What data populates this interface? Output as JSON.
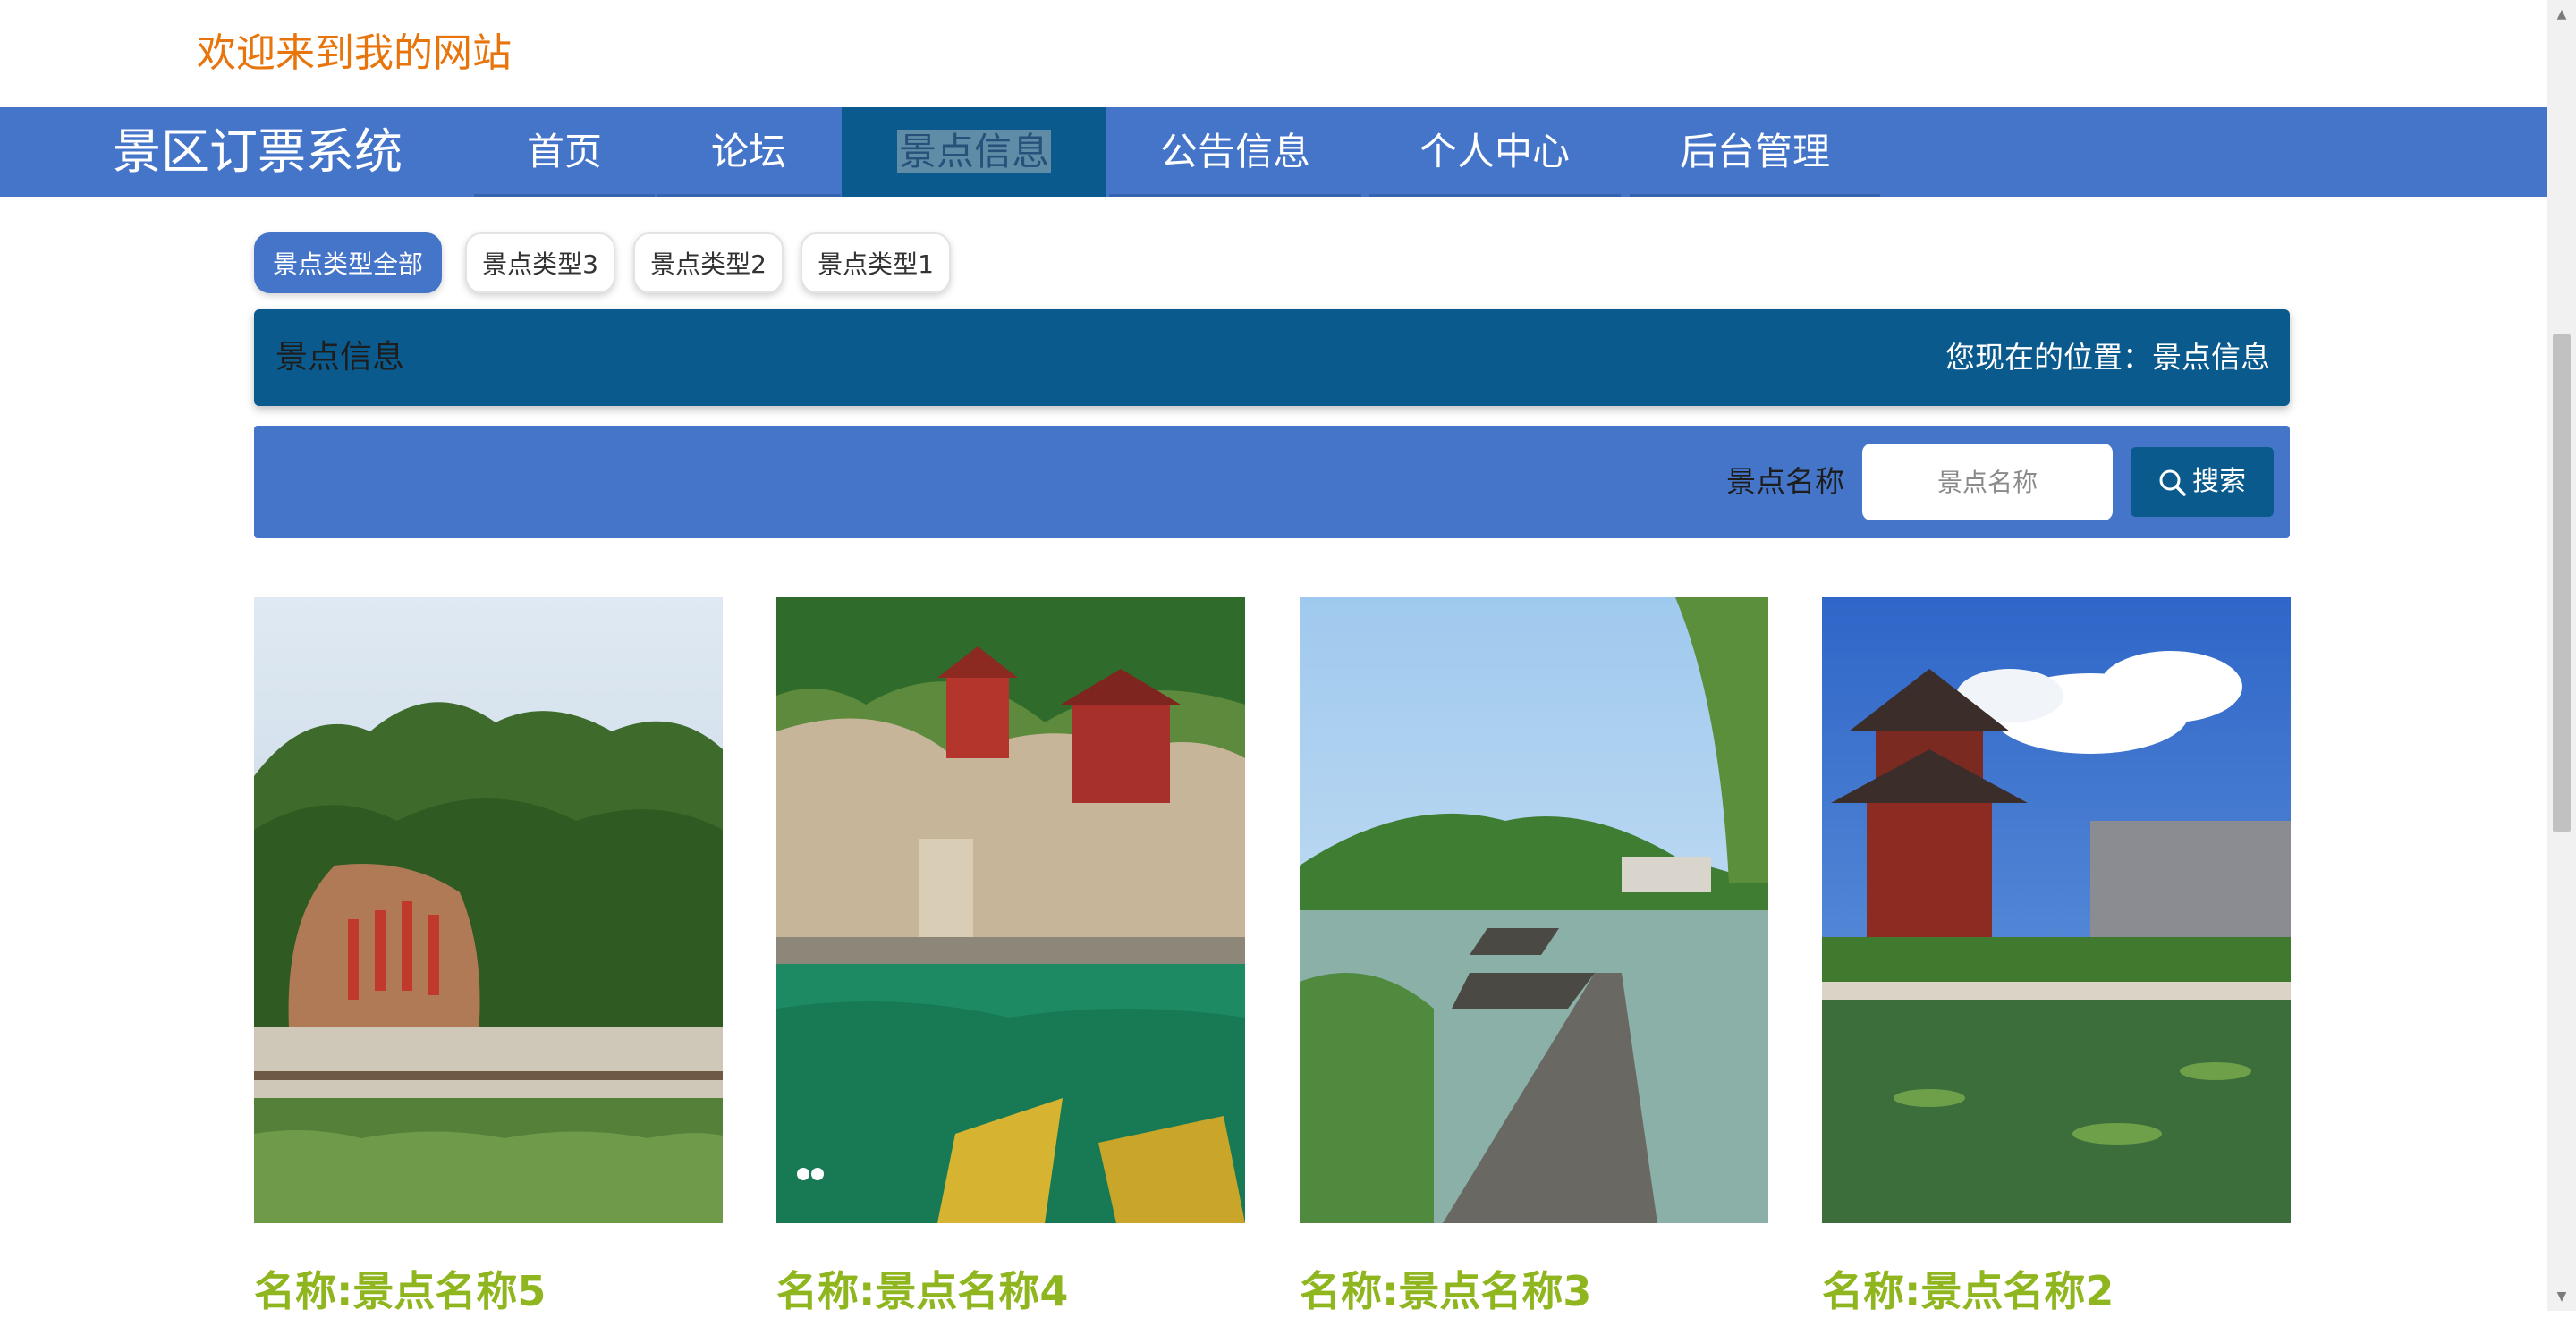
{
  "header": {
    "welcome": "欢迎来到我的网站"
  },
  "navbar": {
    "brand": "景区订票系统",
    "items": [
      {
        "label": "首页"
      },
      {
        "label": "论坛"
      },
      {
        "label": "景点信息",
        "active": true
      },
      {
        "label": "公告信息"
      },
      {
        "label": "个人中心"
      },
      {
        "label": "后台管理"
      }
    ]
  },
  "filters": [
    "景点类型全部",
    "景点类型3",
    "景点类型2",
    "景点类型1"
  ],
  "title_bar": {
    "title": "景点信息",
    "location": "您现在的位置：景点信息"
  },
  "search": {
    "label": "景点名称",
    "placeholder": "景点名称",
    "value": "",
    "button": "搜索",
    "button_icon": "search-icon"
  },
  "cards": [
    {
      "name": "名称:景点名称5",
      "image": "rock-inscription-park-photo"
    },
    {
      "name": "名称:景点名称4",
      "image": "cliff-temple-river-photo"
    },
    {
      "name": "名称:景点名称3",
      "image": "lake-boardwalk-photo"
    },
    {
      "name": "名称:景点名称2",
      "image": "pavilion-pond-photo"
    }
  ],
  "colors": {
    "welcome": "#e8740c",
    "nav_bg": "#4575c8",
    "nav_active": "#0b5a8d",
    "title_bar": "#0b5a8d",
    "card_name": "#8fb61f"
  }
}
